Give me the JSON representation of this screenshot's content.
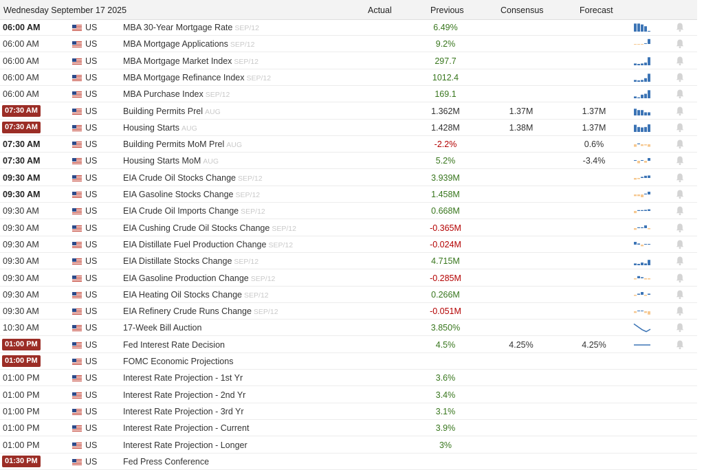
{
  "header": {
    "date": "Wednesday September 17 2025",
    "col_actual": "Actual",
    "col_previous": "Previous",
    "col_consensus": "Consensus",
    "col_forecast": "Forecast"
  },
  "colors": {
    "positive": "#38761d",
    "negative": "#b30000",
    "badge": "#9b2d26",
    "spark_up": "#3c74b5",
    "spark_down": "#f6c890",
    "bell": "#d4d4d4"
  },
  "rows": [
    {
      "time": "06:00 AM",
      "style": "bold",
      "country": "US",
      "event": "MBA 30-Year Mortgage Rate",
      "ref": "SEP/12",
      "actual": "",
      "previous": "6.49%",
      "prev_sign": "pos",
      "consensus": "",
      "forecast": "",
      "spark": [
        0.9,
        0.9,
        0.8,
        0.6,
        0.08
      ],
      "spark_type": "bar"
    },
    {
      "time": "06:00 AM",
      "style": "normal",
      "country": "US",
      "event": "MBA Mortgage Applications",
      "ref": "SEP/12",
      "actual": "",
      "previous": "9.2%",
      "prev_sign": "pos",
      "consensus": "",
      "forecast": "",
      "spark": [
        -0.1,
        -0.1,
        -0.1,
        0.1,
        0.9
      ],
      "spark_type": "bar"
    },
    {
      "time": "06:00 AM",
      "style": "normal",
      "country": "US",
      "event": "MBA Mortgage Market Index",
      "ref": "SEP/12",
      "actual": "",
      "previous": "297.7",
      "prev_sign": "pos",
      "consensus": "",
      "forecast": "",
      "spark": [
        0.2,
        0.15,
        0.2,
        0.3,
        0.9
      ],
      "spark_type": "bar"
    },
    {
      "time": "06:00 AM",
      "style": "normal",
      "country": "US",
      "event": "MBA Mortgage Refinance Index",
      "ref": "SEP/12",
      "actual": "",
      "previous": "1012.4",
      "prev_sign": "pos",
      "consensus": "",
      "forecast": "",
      "spark": [
        0.2,
        0.15,
        0.2,
        0.4,
        0.9
      ],
      "spark_type": "bar"
    },
    {
      "time": "06:00 AM",
      "style": "normal",
      "country": "US",
      "event": "MBA Purchase Index",
      "ref": "SEP/12",
      "actual": "",
      "previous": "169.1",
      "prev_sign": "pos",
      "consensus": "",
      "forecast": "",
      "spark": [
        0.2,
        0.1,
        0.4,
        0.5,
        0.9
      ],
      "spark_type": "bar"
    },
    {
      "time": "07:30 AM",
      "style": "badge",
      "country": "US",
      "event": "Building Permits Prel",
      "ref": "AUG",
      "actual": "",
      "previous": "1.362M",
      "prev_sign": "plain",
      "consensus": "1.37M",
      "forecast": "1.37M",
      "spark": [
        0.75,
        0.6,
        0.6,
        0.35,
        0.35
      ],
      "spark_type": "bar"
    },
    {
      "time": "07:30 AM",
      "style": "badge",
      "country": "US",
      "event": "Housing Starts",
      "ref": "AUG",
      "actual": "",
      "previous": "1.428M",
      "prev_sign": "plain",
      "consensus": "1.38M",
      "forecast": "1.37M",
      "spark": [
        0.8,
        0.55,
        0.5,
        0.55,
        0.85
      ],
      "spark_type": "bar"
    },
    {
      "time": "07:30 AM",
      "style": "bold",
      "country": "US",
      "event": "Building Permits MoM Prel",
      "ref": "AUG",
      "actual": "",
      "previous": "-2.2%",
      "prev_sign": "neg",
      "consensus": "",
      "forecast": "0.6%",
      "spark": [
        -0.45,
        0.15,
        -0.3,
        -0.2,
        -0.45
      ],
      "spark_type": "bar"
    },
    {
      "time": "07:30 AM",
      "style": "bold",
      "country": "US",
      "event": "Housing Starts MoM",
      "ref": "AUG",
      "actual": "",
      "previous": "5.2%",
      "prev_sign": "pos",
      "consensus": "",
      "forecast": "-3.4%",
      "spark": [
        0.1,
        -0.45,
        0.1,
        -0.35,
        0.5
      ],
      "spark_type": "bar"
    },
    {
      "time": "09:30 AM",
      "style": "bold",
      "country": "US",
      "event": "EIA Crude Oil Stocks Change",
      "ref": "SEP/12",
      "actual": "",
      "previous": "3.939M",
      "prev_sign": "pos",
      "consensus": "",
      "forecast": "",
      "spark": [
        -0.3,
        -0.2,
        0.2,
        0.4,
        0.45
      ],
      "spark_type": "bar"
    },
    {
      "time": "09:30 AM",
      "style": "bold",
      "country": "US",
      "event": "EIA Gasoline Stocks Change",
      "ref": "SEP/12",
      "actual": "",
      "previous": "1.458M",
      "prev_sign": "pos",
      "consensus": "",
      "forecast": "",
      "spark": [
        -0.3,
        -0.3,
        -0.5,
        0.15,
        0.5
      ],
      "spark_type": "bar"
    },
    {
      "time": "09:30 AM",
      "style": "normal",
      "country": "US",
      "event": "EIA Crude Oil Imports Change",
      "ref": "SEP/12",
      "actual": "",
      "previous": "0.668M",
      "prev_sign": "pos",
      "consensus": "",
      "forecast": "",
      "spark": [
        -0.4,
        0.15,
        0.15,
        0.2,
        0.3
      ],
      "spark_type": "bar"
    },
    {
      "time": "09:30 AM",
      "style": "normal",
      "country": "US",
      "event": "EIA Cushing Crude Oil Stocks Change",
      "ref": "SEP/12",
      "actual": "",
      "previous": "-0.365M",
      "prev_sign": "neg",
      "consensus": "",
      "forecast": "",
      "spark": [
        -0.3,
        0.15,
        0.15,
        0.5,
        -0.2
      ],
      "spark_type": "bar"
    },
    {
      "time": "09:30 AM",
      "style": "normal",
      "country": "US",
      "event": "EIA Distillate Fuel Production Change",
      "ref": "SEP/12",
      "actual": "",
      "previous": "-0.024M",
      "prev_sign": "neg",
      "consensus": "",
      "forecast": "",
      "spark": [
        0.5,
        0.2,
        -0.3,
        0.08,
        0.08
      ],
      "spark_type": "bar"
    },
    {
      "time": "09:30 AM",
      "style": "normal",
      "country": "US",
      "event": "EIA Distillate Stocks Change",
      "ref": "SEP/12",
      "actual": "",
      "previous": "4.715M",
      "prev_sign": "pos",
      "consensus": "",
      "forecast": "",
      "spark": [
        0.2,
        0.15,
        0.3,
        0.2,
        0.6
      ],
      "spark_type": "bar"
    },
    {
      "time": "09:30 AM",
      "style": "normal",
      "country": "US",
      "event": "EIA Gasoline Production Change",
      "ref": "SEP/12",
      "actual": "",
      "previous": "-0.285M",
      "prev_sign": "neg",
      "consensus": "",
      "forecast": "",
      "spark": [
        -0.2,
        0.4,
        0.2,
        -0.2,
        -0.2
      ],
      "spark_type": "bar"
    },
    {
      "time": "09:30 AM",
      "style": "normal",
      "country": "US",
      "event": "EIA Heating Oil Stocks Change",
      "ref": "SEP/12",
      "actual": "",
      "previous": "0.266M",
      "prev_sign": "pos",
      "consensus": "",
      "forecast": "",
      "spark": [
        -0.2,
        0.2,
        0.5,
        -0.2,
        0.2
      ],
      "spark_type": "bar"
    },
    {
      "time": "09:30 AM",
      "style": "normal",
      "country": "US",
      "event": "EIA Refinery Crude Runs Change",
      "ref": "SEP/12",
      "actual": "",
      "previous": "-0.051M",
      "prev_sign": "neg",
      "consensus": "",
      "forecast": "",
      "spark": [
        -0.3,
        0.08,
        0.08,
        -0.3,
        -0.6
      ],
      "spark_type": "bar"
    },
    {
      "time": "10:30 AM",
      "style": "normal",
      "country": "US",
      "event": "17-Week Bill Auction",
      "ref": "",
      "actual": "",
      "previous": "3.850%",
      "prev_sign": "pos",
      "consensus": "",
      "forecast": "",
      "spark": [
        0.9,
        0.6,
        0.3,
        0.1,
        0.35
      ],
      "spark_type": "line"
    },
    {
      "time": "01:00 PM",
      "style": "badge",
      "country": "US",
      "event": "Fed Interest Rate Decision",
      "ref": "",
      "actual": "",
      "previous": "4.5%",
      "prev_sign": "pos",
      "consensus": "4.25%",
      "forecast": "4.25%",
      "spark": [
        0.5,
        0.5,
        0.5,
        0.5,
        0.5
      ],
      "spark_type": "line"
    },
    {
      "time": "01:00 PM",
      "style": "badge",
      "country": "US",
      "event": "FOMC Economic Projections",
      "ref": "",
      "actual": "",
      "previous": "",
      "prev_sign": "pos",
      "consensus": "",
      "forecast": "",
      "spark": [],
      "spark_type": "none"
    },
    {
      "time": "01:00 PM",
      "style": "normal",
      "country": "US",
      "event": "Interest Rate Projection - 1st Yr",
      "ref": "",
      "actual": "",
      "previous": "3.6%",
      "prev_sign": "pos",
      "consensus": "",
      "forecast": "",
      "spark": [],
      "spark_type": "none"
    },
    {
      "time": "01:00 PM",
      "style": "normal",
      "country": "US",
      "event": "Interest Rate Projection - 2nd Yr",
      "ref": "",
      "actual": "",
      "previous": "3.4%",
      "prev_sign": "pos",
      "consensus": "",
      "forecast": "",
      "spark": [],
      "spark_type": "none"
    },
    {
      "time": "01:00 PM",
      "style": "normal",
      "country": "US",
      "event": "Interest Rate Projection - 3rd Yr",
      "ref": "",
      "actual": "",
      "previous": "3.1%",
      "prev_sign": "pos",
      "consensus": "",
      "forecast": "",
      "spark": [],
      "spark_type": "none"
    },
    {
      "time": "01:00 PM",
      "style": "normal",
      "country": "US",
      "event": "Interest Rate Projection - Current",
      "ref": "",
      "actual": "",
      "previous": "3.9%",
      "prev_sign": "pos",
      "consensus": "",
      "forecast": "",
      "spark": [],
      "spark_type": "none"
    },
    {
      "time": "01:00 PM",
      "style": "normal",
      "country": "US",
      "event": "Interest Rate Projection - Longer",
      "ref": "",
      "actual": "",
      "previous": "3%",
      "prev_sign": "pos",
      "consensus": "",
      "forecast": "",
      "spark": [],
      "spark_type": "none"
    },
    {
      "time": "01:30 PM",
      "style": "badge",
      "country": "US",
      "event": "Fed Press Conference",
      "ref": "",
      "actual": "",
      "previous": "",
      "prev_sign": "pos",
      "consensus": "",
      "forecast": "",
      "spark": [],
      "spark_type": "none"
    }
  ]
}
